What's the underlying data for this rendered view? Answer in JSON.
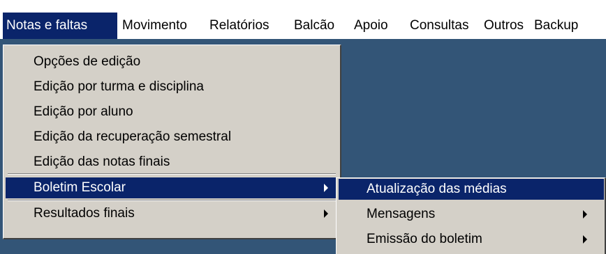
{
  "menubar": {
    "items": [
      {
        "label": "Notas e faltas",
        "active": true
      },
      {
        "label": "Movimento"
      },
      {
        "label": "Relatórios"
      },
      {
        "label": "Balcão"
      },
      {
        "label": "Apoio"
      },
      {
        "label": "Consultas"
      },
      {
        "label": "Outros"
      },
      {
        "label": "Backup"
      }
    ]
  },
  "dropdown": {
    "items": [
      {
        "label": "Opções de edição"
      },
      {
        "label": "Edição por turma e disciplina"
      },
      {
        "label": "Edição por aluno"
      },
      {
        "label": "Edição da recuperação semestral"
      },
      {
        "label": "Edição das notas finais"
      },
      {
        "label": "Boletim Escolar",
        "highlighted": true,
        "has_submenu": true
      },
      {
        "label": "Resultados finais",
        "has_submenu": true
      }
    ]
  },
  "submenu": {
    "items": [
      {
        "label": "Atualização das médias",
        "highlighted": true
      },
      {
        "label": "Mensagens",
        "has_submenu": true
      },
      {
        "label": "Emissão do boletim",
        "has_submenu": true
      }
    ]
  },
  "colors": {
    "highlight": "#0a246a",
    "menu_background": "#d4d0c8",
    "workspace": "#335577"
  }
}
